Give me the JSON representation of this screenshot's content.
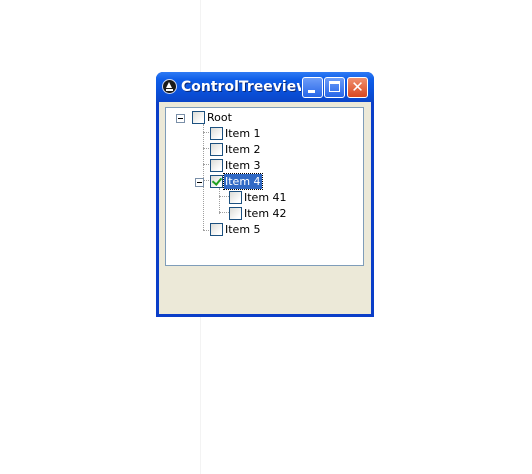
{
  "window": {
    "title": "ControlTreeview...",
    "colors": {
      "titlebar": "#0a52dc",
      "frame": "#0a3ec8",
      "client": "#ece9d8",
      "selection": "#316ac5"
    }
  },
  "tree": {
    "root": {
      "label": "Root",
      "checked": false,
      "expanded": true
    },
    "items": [
      {
        "label": "Item 1",
        "checked": false
      },
      {
        "label": "Item 2",
        "checked": false
      },
      {
        "label": "Item 3",
        "checked": false
      },
      {
        "label": "Item 4",
        "checked": true,
        "selected": true,
        "expanded": true,
        "children": [
          {
            "label": "Item 41",
            "checked": false
          },
          {
            "label": "Item 42",
            "checked": false
          }
        ]
      },
      {
        "label": "Item 5",
        "checked": false
      }
    ]
  }
}
